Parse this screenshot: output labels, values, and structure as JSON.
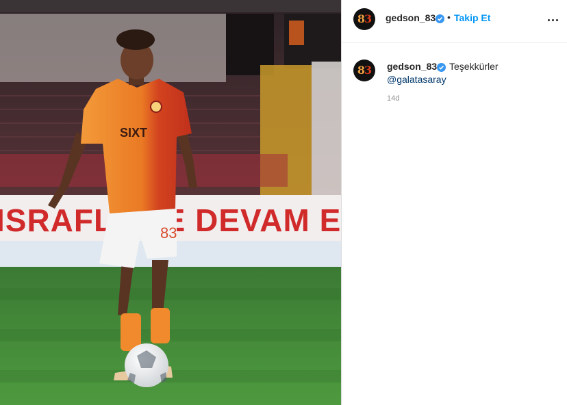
{
  "post": {
    "image_alt": "",
    "banner_text": "ISRAFLAME DEVAM E"
  },
  "header": {
    "avatar_text_a": "8",
    "avatar_text_b": "3",
    "username": "gedson_83",
    "verified_icon": "verified-badge-icon",
    "separator": "•",
    "follow_label": "Takip Et",
    "more_icon": "more-options-icon"
  },
  "caption": {
    "username": "gedson_83",
    "text": "Teşekkürler",
    "mention": "@galatasaray",
    "timestamp": "14d"
  },
  "colors": {
    "accent": "#0095f6",
    "verified": "#3897f0",
    "jersey_orange": "#f08a2c",
    "jersey_red": "#c8321e"
  }
}
